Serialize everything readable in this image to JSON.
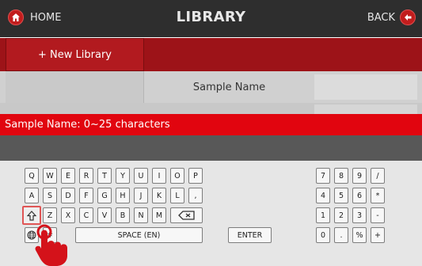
{
  "header": {
    "home_label": "HOME",
    "title": "LIBRARY",
    "back_label": "BACK",
    "home_icon": "home-icon",
    "back_icon": "back-arrow-icon"
  },
  "library": {
    "new_library_label": "+ New Library",
    "column_header": "Sample Name"
  },
  "hint": {
    "text": "Sample Name: 0~25 characters"
  },
  "keyboard": {
    "row1": [
      "Q",
      "W",
      "E",
      "R",
      "T",
      "Y",
      "U",
      "I",
      "O",
      "P"
    ],
    "row2": [
      "A",
      "S",
      "D",
      "F",
      "G",
      "H",
      "J",
      "K",
      "L",
      ","
    ],
    "row3": [
      "Z",
      "X",
      "C",
      "V",
      "B",
      "N",
      "M"
    ],
    "shift_icon": "shift-up-arrow-icon",
    "backspace_icon": "backspace-icon",
    "globe_icon": "globe-icon",
    "symbol_key": "#",
    "space_label": "SPACE (EN)",
    "enter_label": "ENTER",
    "numpad_row1": [
      "7",
      "8",
      "9",
      "/"
    ],
    "numpad_row2": [
      "4",
      "5",
      "6",
      "*"
    ],
    "numpad_row3": [
      "1",
      "2",
      "3",
      "-"
    ],
    "numpad_row4": [
      "0",
      ".",
      "%",
      "+"
    ]
  },
  "colors": {
    "accent_red": "#c21d1d",
    "hint_red": "#e1050f",
    "header_bg": "#2e2e2e"
  }
}
